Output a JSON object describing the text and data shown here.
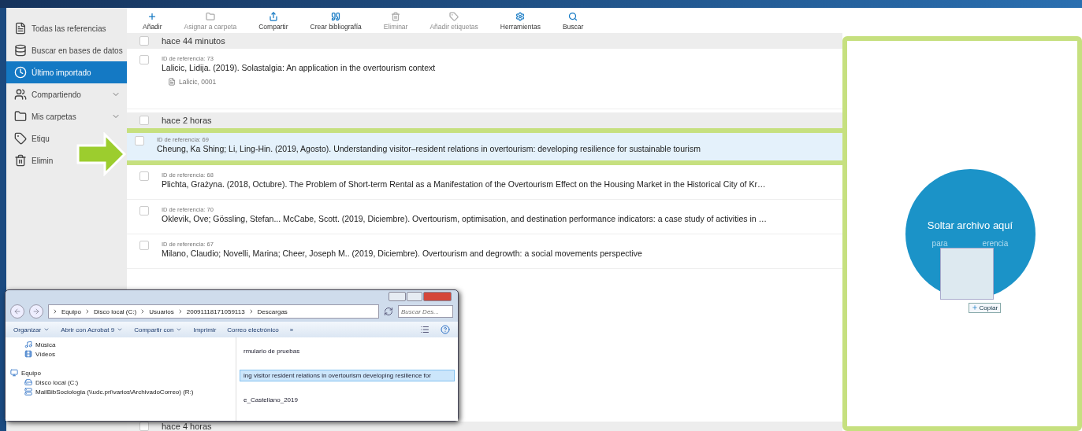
{
  "sidebar": {
    "items": [
      {
        "label": "Todas las referencias",
        "selected": false,
        "expandable": false
      },
      {
        "label": "Buscar en bases de datos",
        "selected": false,
        "expandable": false
      },
      {
        "label": "Último importado",
        "selected": true,
        "expandable": false
      },
      {
        "label": "Compartiendo",
        "selected": false,
        "expandable": true
      },
      {
        "label": "Mis carpetas",
        "selected": false,
        "expandable": true
      },
      {
        "label": "Etiqu",
        "selected": false,
        "expandable": false
      },
      {
        "label": "Elimin",
        "selected": false,
        "expandable": false
      }
    ]
  },
  "toolbar": [
    {
      "label": "Añadir",
      "disabled": false
    },
    {
      "label": "Asignar a carpeta",
      "disabled": true
    },
    {
      "label": "Compartir",
      "disabled": false
    },
    {
      "label": "Crear bibliografía",
      "disabled": false
    },
    {
      "label": "Eliminar",
      "disabled": true
    },
    {
      "label": "Añadir etiquetas",
      "disabled": true
    },
    {
      "label": "Herramientas",
      "disabled": false
    },
    {
      "label": "Buscar",
      "disabled": false
    }
  ],
  "groups": [
    {
      "title": "hace 44 minutos",
      "checked": false,
      "references": [
        {
          "id": "ID de referencia: 73",
          "citation": "Lalicic, Lidija. (2019). Solastalgia: An application in the overtourism context",
          "attachment": "Lalicic, 0001",
          "selected": false,
          "checked": false
        }
      ]
    },
    {
      "title": "hace 2 horas",
      "checked": false,
      "references": [
        {
          "id": "ID de referencia: 69",
          "citation": "Cheung, Ka Shing; Li, Ling-Hin. (2019, Agosto). Understanding visitor–resident relations in overtourism: developing resilience for sustainable tourism",
          "selected": true,
          "checked": false
        },
        {
          "id": "ID de referencia: 68",
          "citation": "Plichta, Grażyna. (2018, Octubre). The Problem of Short-term Rental as a Manifestation of the Overtourism Effect on the Housing Market in the Historical City of Kr…",
          "selected": false,
          "checked": false
        },
        {
          "id": "ID de referencia: 70",
          "citation": "Oklevik, Ove; Gössling, Stefan... McCabe, Scott. (2019, Diciembre). Overtourism, optimisation, and destination performance indicators: a case study of activities in …",
          "selected": false,
          "checked": false
        },
        {
          "id": "ID de referencia: 67",
          "citation": "Milano, Claudio; Novelli, Marina; Cheer, Joseph M.. (2019, Diciembre). Overtourism and degrowth: a social movements perspective",
          "selected": false,
          "checked": false
        }
      ]
    },
    {
      "title": "hace 4 horas",
      "checked": false
    }
  ],
  "drop_zone": {
    "title": "Soltar archivo aquí",
    "subtitle_start": "para",
    "subtitle_end": "erencia",
    "copy_badge": "Copiar"
  },
  "explorer": {
    "breadcrumb": [
      "Equipo",
      "Disco local (C:)",
      "Usuarios",
      "20091118171059113",
      "Descargas"
    ],
    "search": {
      "placeholder": "Buscar Des..."
    },
    "commands": [
      {
        "label": "Organizar",
        "dropdown": true
      },
      {
        "label": "Abrir con Acrobat 9",
        "dropdown": true
      },
      {
        "label": "Compartir con",
        "dropdown": true
      },
      {
        "label": "Imprimir",
        "dropdown": false
      },
      {
        "label": "Correo electrónico",
        "dropdown": false
      }
    ],
    "more": "»",
    "nav": [
      {
        "label": "Música",
        "kind": "child"
      },
      {
        "label": "Vídeos",
        "kind": "child"
      },
      {
        "label": "Equipo",
        "kind": "section"
      },
      {
        "label": "Disco local (C:)",
        "kind": "child"
      },
      {
        "label": "MailBibSociologia (\\\\udc.pri\\varios\\ArchivadoCorreo) (R:)",
        "kind": "child"
      }
    ],
    "files": [
      {
        "name": "rmulario de pruebas",
        "selected": false
      },
      {
        "name": "ing visitor resident relations in overtourism developing resilience for",
        "selected": true
      },
      {
        "name": "e_Castellano_2019",
        "selected": false
      }
    ]
  }
}
